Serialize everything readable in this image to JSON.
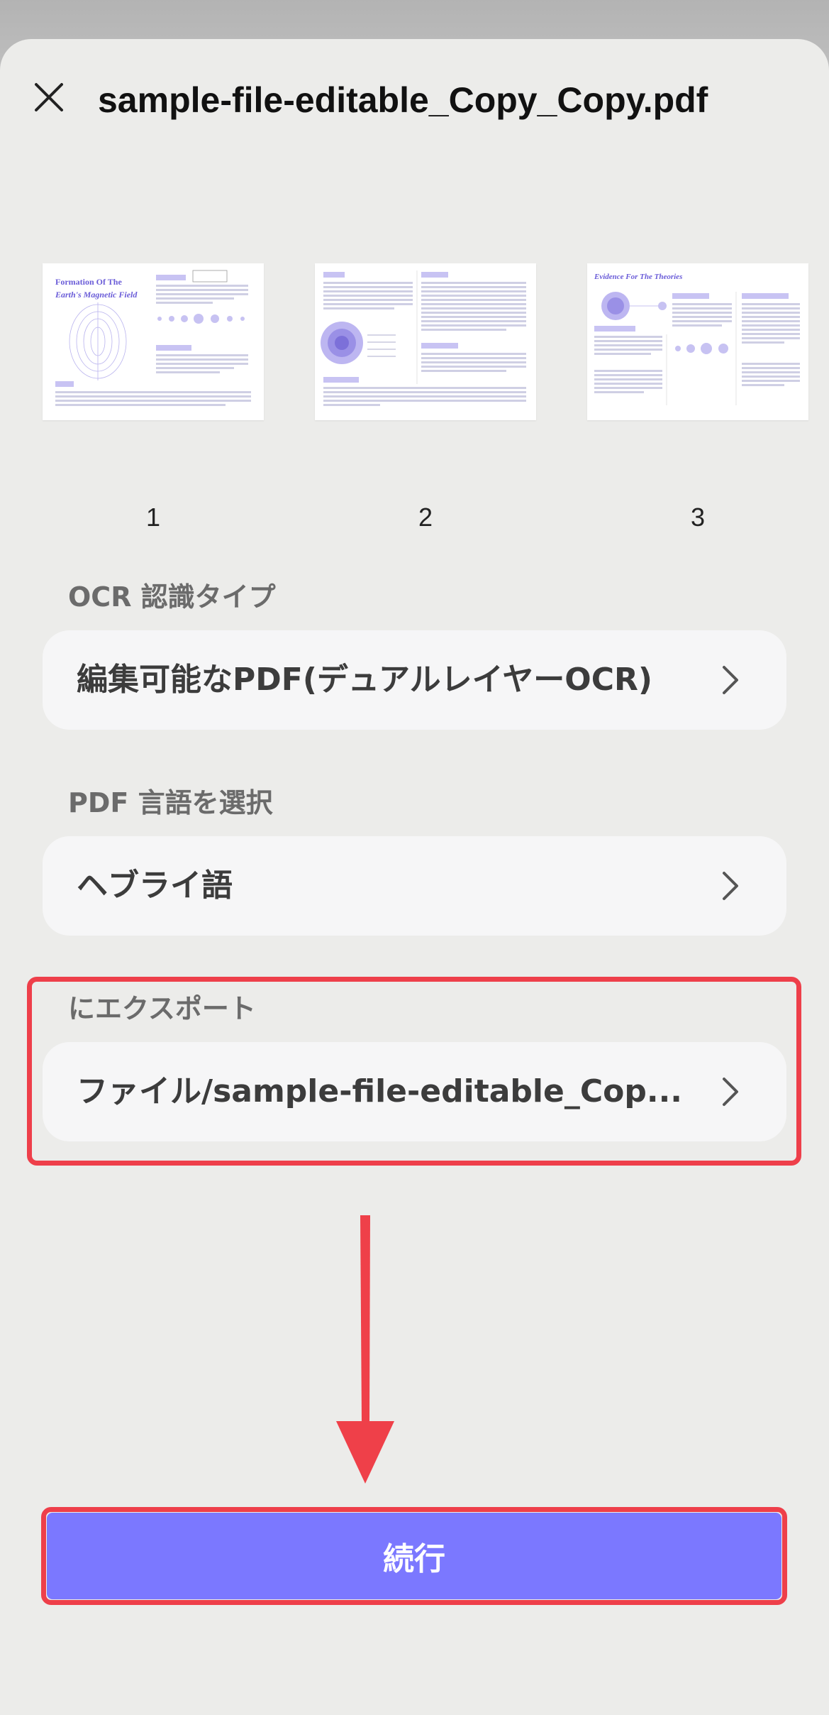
{
  "header": {
    "title": "sample-file-editable_Copy_Copy.pdf",
    "close_icon": "close-icon"
  },
  "pages": [
    {
      "number": "1",
      "heading_line1": "Formation Of The",
      "heading_line2": "Earth's Magnetic Field"
    },
    {
      "number": "2"
    },
    {
      "number": "3",
      "heading": "Evidence For The Theories"
    }
  ],
  "ocr_type": {
    "label": "OCR 認識タイプ",
    "value": "編集可能なPDF(デュアルレイヤーOCR)"
  },
  "pdf_language": {
    "label": "PDF 言語を選択",
    "value": "ヘブライ語"
  },
  "export_to": {
    "label": "にエクスポート",
    "value": "ファイル/sample-file-editable_Cop..."
  },
  "continue_button": {
    "label": "続行"
  },
  "colors": {
    "accent": "#7b78ff",
    "highlight": "#ee3f4a",
    "thumb_accent": "#6a5cd8"
  }
}
